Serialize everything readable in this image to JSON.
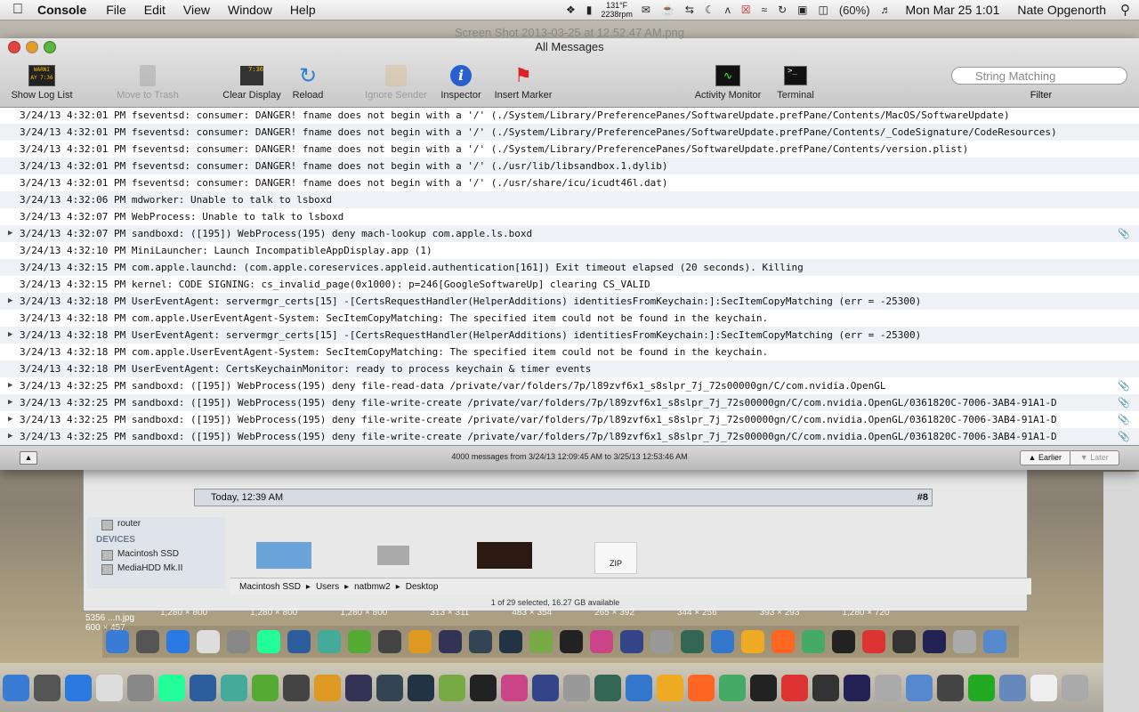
{
  "menubar": {
    "app_name": "Console",
    "menus": [
      "File",
      "Edit",
      "View",
      "Window",
      "Help"
    ],
    "temp": "131°F",
    "rpm": "2238rpm",
    "battery": "(60%)",
    "clock": "Mon Mar 25  1:01",
    "user": "Nate Opgenorth"
  },
  "window": {
    "document_title": "Screen Shot 2013-03-25 at 12.52.47 AM.png",
    "title": "All Messages"
  },
  "toolbar": {
    "show_log_list": "Show Log List",
    "log_icon_text": "WARNI\nAY 7:36",
    "move_to_trash": "Move to Trash",
    "clear_display": "Clear Display",
    "clear_icon_text": "7:36",
    "reload": "Reload",
    "ignore_sender": "Ignore Sender",
    "inspector": "Inspector",
    "insert_marker": "Insert Marker",
    "activity_monitor": "Activity Monitor",
    "terminal": "Terminal",
    "search_placeholder": "String Matching",
    "filter": "Filter"
  },
  "log": [
    {
      "text": "3/24/13 4:32:01 PM fseventsd: consumer: DANGER! fname does not begin with a '/' (./System/Library/PreferencePanes/SoftwareUpdate.prefPane/Contents/MacOS/SoftwareUpdate)",
      "expand": false,
      "attach": false
    },
    {
      "text": "3/24/13 4:32:01 PM fseventsd: consumer: DANGER! fname does not begin with a '/' (./System/Library/PreferencePanes/SoftwareUpdate.prefPane/Contents/_CodeSignature/CodeResources)",
      "expand": false,
      "attach": false
    },
    {
      "text": "3/24/13 4:32:01 PM fseventsd: consumer: DANGER! fname does not begin with a '/' (./System/Library/PreferencePanes/SoftwareUpdate.prefPane/Contents/version.plist)",
      "expand": false,
      "attach": false
    },
    {
      "text": "3/24/13 4:32:01 PM fseventsd: consumer: DANGER! fname does not begin with a '/' (./usr/lib/libsandbox.1.dylib)",
      "expand": false,
      "attach": false
    },
    {
      "text": "3/24/13 4:32:01 PM fseventsd: consumer: DANGER! fname does not begin with a '/' (./usr/share/icu/icudt46l.dat)",
      "expand": false,
      "attach": false
    },
    {
      "text": "3/24/13 4:32:06 PM mdworker: Unable to talk to lsboxd",
      "expand": false,
      "attach": false
    },
    {
      "text": "3/24/13 4:32:07 PM WebProcess: Unable to talk to lsboxd",
      "expand": false,
      "attach": false
    },
    {
      "text": "3/24/13 4:32:07 PM sandboxd: ([195]) WebProcess(195) deny mach-lookup com.apple.ls.boxd",
      "expand": true,
      "attach": true
    },
    {
      "text": "3/24/13 4:32:10 PM MiniLauncher: Launch IncompatibleAppDisplay.app (1)",
      "expand": false,
      "attach": false
    },
    {
      "text": "3/24/13 4:32:15 PM com.apple.launchd: (com.apple.coreservices.appleid.authentication[161]) Exit timeout elapsed (20 seconds). Killing",
      "expand": false,
      "attach": false
    },
    {
      "text": "3/24/13 4:32:15 PM kernel: CODE SIGNING: cs_invalid_page(0x1000): p=246[GoogleSoftwareUp] clearing CS_VALID",
      "expand": false,
      "attach": false
    },
    {
      "text": "3/24/13 4:32:18 PM UserEventAgent: servermgr_certs[15] -[CertsRequestHandler(HelperAdditions) identitiesFromKeychain:]:SecItemCopyMatching (err = -25300)",
      "expand": true,
      "attach": false
    },
    {
      "text": "3/24/13 4:32:18 PM com.apple.UserEventAgent-System: SecItemCopyMatching: The specified item could not be found in the keychain.",
      "expand": false,
      "attach": false
    },
    {
      "text": "3/24/13 4:32:18 PM UserEventAgent: servermgr_certs[15] -[CertsRequestHandler(HelperAdditions) identitiesFromKeychain:]:SecItemCopyMatching (err = -25300)",
      "expand": true,
      "attach": false
    },
    {
      "text": "3/24/13 4:32:18 PM com.apple.UserEventAgent-System: SecItemCopyMatching: The specified item could not be found in the keychain.",
      "expand": false,
      "attach": false
    },
    {
      "text": "3/24/13 4:32:18 PM UserEventAgent: CertsKeychainMonitor: ready to process keychain & timer events",
      "expand": false,
      "attach": false
    },
    {
      "text": "3/24/13 4:32:25 PM sandboxd: ([195]) WebProcess(195) deny file-read-data /private/var/folders/7p/l89zvf6x1_s8slpr_7j_72s00000gn/C/com.nvidia.OpenGL",
      "expand": true,
      "attach": true
    },
    {
      "text": "3/24/13 4:32:25 PM sandboxd: ([195]) WebProcess(195) deny file-write-create /private/var/folders/7p/l89zvf6x1_s8slpr_7j_72s00000gn/C/com.nvidia.OpenGL/0361820C-7006-3AB4-91A1-D",
      "expand": true,
      "attach": true
    },
    {
      "text": "3/24/13 4:32:25 PM sandboxd: ([195]) WebProcess(195) deny file-write-create /private/var/folders/7p/l89zvf6x1_s8slpr_7j_72s00000gn/C/com.nvidia.OpenGL/0361820C-7006-3AB4-91A1-D",
      "expand": true,
      "attach": true
    },
    {
      "text": "3/24/13 4:32:25 PM sandboxd: ([195]) WebProcess(195) deny file-write-create /private/var/folders/7p/l89zvf6x1_s8slpr_7j_72s00000gn/C/com.nvidia.OpenGL/0361820C-7006-3AB4-91A1-D",
      "expand": true,
      "attach": true
    }
  ],
  "statusbar": {
    "message": "4000 messages from 3/24/13 12:09:45 AM to 3/25/13 12:53:46 AM",
    "earlier": "Earlier",
    "later": "Later"
  },
  "finder": {
    "today_row": "Today, 12:39 AM",
    "today_num": "#8",
    "router": "router",
    "devices_header": "DEVICES",
    "devices": [
      "Macintosh SSD",
      "MediaHDD Mk.II"
    ],
    "path": [
      "Macintosh SSD",
      "Users",
      "natbmw2",
      "Desktop"
    ],
    "status": "1 of 29 selected, 16.27 GB available",
    "zip_label": "ZIP"
  },
  "desktop": {
    "file_label": "5356 ...n.jpg",
    "file_size": "600 × 457",
    "thumb_sizes": [
      "1,280 × 800",
      "1,280 × 800",
      "1,280 × 800",
      "313 × 311",
      "483 × 354",
      "265 × 392",
      "344 × 256",
      "393 × 293",
      "1,280 × 720"
    ]
  },
  "dock_colors": [
    "#3a7bd5",
    "#555",
    "#2a7ae2",
    "#ddd",
    "#888",
    "#2f9",
    "#2c5e9e",
    "#4a9",
    "#5a3",
    "#444",
    "#d92",
    "#335",
    "#345",
    "#234",
    "#7a4",
    "#222",
    "#c48",
    "#348",
    "#999",
    "#365",
    "#37c",
    "#ea2",
    "#f62",
    "#4a6",
    "#222",
    "#d33",
    "#333",
    "#225",
    "#aaa",
    "#58c",
    "#444",
    "#2a2",
    "#68b",
    "#eee",
    "#aaa"
  ],
  "colors": {
    "selected_accent": "#3875d7",
    "row_alt": "#eef2f7"
  }
}
